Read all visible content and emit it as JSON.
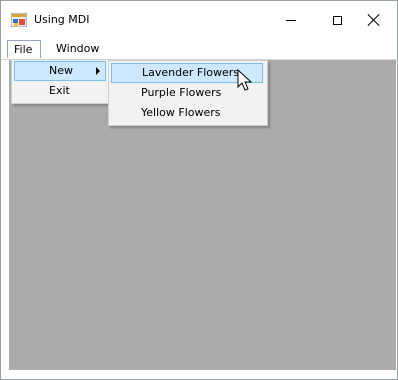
{
  "window": {
    "title": "Using MDI"
  },
  "menubar": {
    "file": "File",
    "window": "Window"
  },
  "file_menu": {
    "new": "New",
    "exit": "Exit"
  },
  "new_submenu": {
    "items": [
      "Lavender Flowers",
      "Purple Flowers",
      "Yellow Flowers"
    ],
    "highlighted": "Lavender Flowers"
  },
  "colors": {
    "mdi_background": "#ababab",
    "highlight": "#cde8ff",
    "highlight_border": "#7dbfe9",
    "menu_background": "#f2f2f2"
  },
  "icons": {
    "app": "application-icon",
    "minimize": "minimize-icon",
    "maximize": "maximize-icon",
    "close": "close-icon",
    "submenu": "submenu-arrow-icon",
    "cursor": "mouse-pointer-icon"
  }
}
